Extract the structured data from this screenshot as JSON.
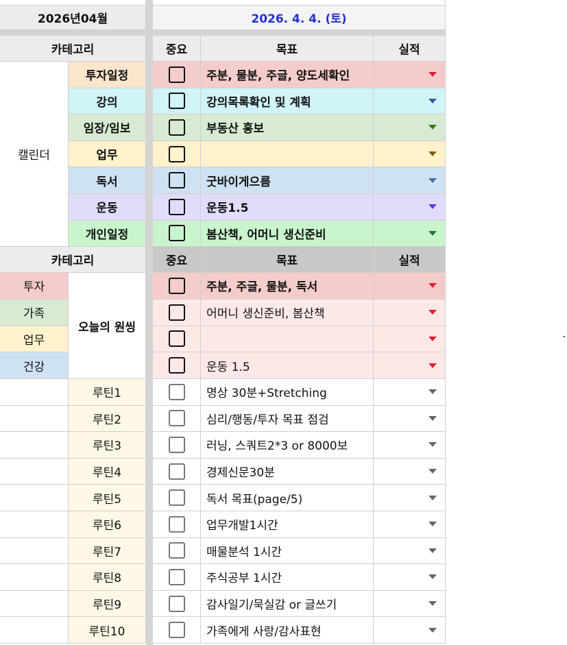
{
  "header": {
    "month": "2026년04월",
    "date": "2026. 4. 4. (토)",
    "date_color": "#2233cc"
  },
  "columns": {
    "category": "카테고리",
    "importance": "중요",
    "goal": "목표",
    "result": "실적"
  },
  "calendar_label": "캘린더",
  "calendar_rows": [
    {
      "category": "투자일정",
      "goal": "주분, 물분, 주글, 양도세확인",
      "bg": "#fce5cd",
      "goal_bg": "#f4cccc",
      "arrow": "#e0202f"
    },
    {
      "category": "강의",
      "goal": "강의목록확인 및 계획",
      "bg": "#d0f4f8",
      "goal_bg": "#d0f4f8",
      "arrow": "#2d5f9a"
    },
    {
      "category": "임장/임보",
      "goal": "부동산 홍보",
      "bg": "#d9ead3",
      "goal_bg": "#d9ead3",
      "arrow": "#38761d"
    },
    {
      "category": "업무",
      "goal": "",
      "bg": "#fff2cc",
      "goal_bg": "#fff2cc",
      "arrow": "#7f6000"
    },
    {
      "category": "독서",
      "goal": "굿바이게으름",
      "bg": "#cfe2f3",
      "goal_bg": "#cfe2f3",
      "arrow": "#3d6fb0"
    },
    {
      "category": "운동",
      "goal": "운동1.5",
      "bg": "#e0dcfb",
      "goal_bg": "#e0dcfb",
      "arrow": "#5a3fd0"
    },
    {
      "category": "개인일정",
      "goal": "봄산책, 어머니 생신준비",
      "bg": "#c9f5cd",
      "goal_bg": "#c9f5cd",
      "arrow": "#1f7a2e"
    }
  ],
  "one_thing_label": "오늘의 원씽",
  "one_thing_categories": [
    {
      "label": "투자",
      "bg": "#f4cccc"
    },
    {
      "label": "가족",
      "bg": "#d9ead3"
    },
    {
      "label": "업무",
      "bg": "#fff2cc"
    },
    {
      "label": "건강",
      "bg": "#cfe2f3"
    }
  ],
  "one_thing_rows": [
    {
      "goal": "주분, 주글, 물분, 독서",
      "bold": true,
      "goal_bg": "#f4cccc"
    },
    {
      "goal": "어머니 생신준비, 봄산책",
      "bold": false,
      "goal_bg": "#fde8e8"
    },
    {
      "goal": "",
      "bold": false,
      "goal_bg": "#fde8e8"
    },
    {
      "goal": "운동 1.5",
      "bold": false,
      "goal_bg": "#fde8e8"
    }
  ],
  "one_thing_arrow": "#e0202f",
  "routine_bg": "#fff8e6",
  "routine_arrow": "#666666",
  "routines": [
    {
      "label": "루틴1",
      "goal": "명상 30분+Stretching"
    },
    {
      "label": "루틴2",
      "goal": "심리/행동/투자 목표 점검"
    },
    {
      "label": "루틴3",
      "goal": "러닝, 스쿼트2*3 or 8000보"
    },
    {
      "label": "루틴4",
      "goal": "경제신문30분"
    },
    {
      "label": "루틴5",
      "goal": "독서 목표(page/5)"
    },
    {
      "label": "루틴6",
      "goal": "업무개발1시간"
    },
    {
      "label": "루틴7",
      "goal": "매물분석 1시간"
    },
    {
      "label": "루틴8",
      "goal": "주식공부 1시간"
    },
    {
      "label": "루틴9",
      "goal": "감사일기/묵실감 or 글쓰기"
    },
    {
      "label": "루틴10",
      "goal": "가족에게 사랑/감사표현"
    }
  ]
}
